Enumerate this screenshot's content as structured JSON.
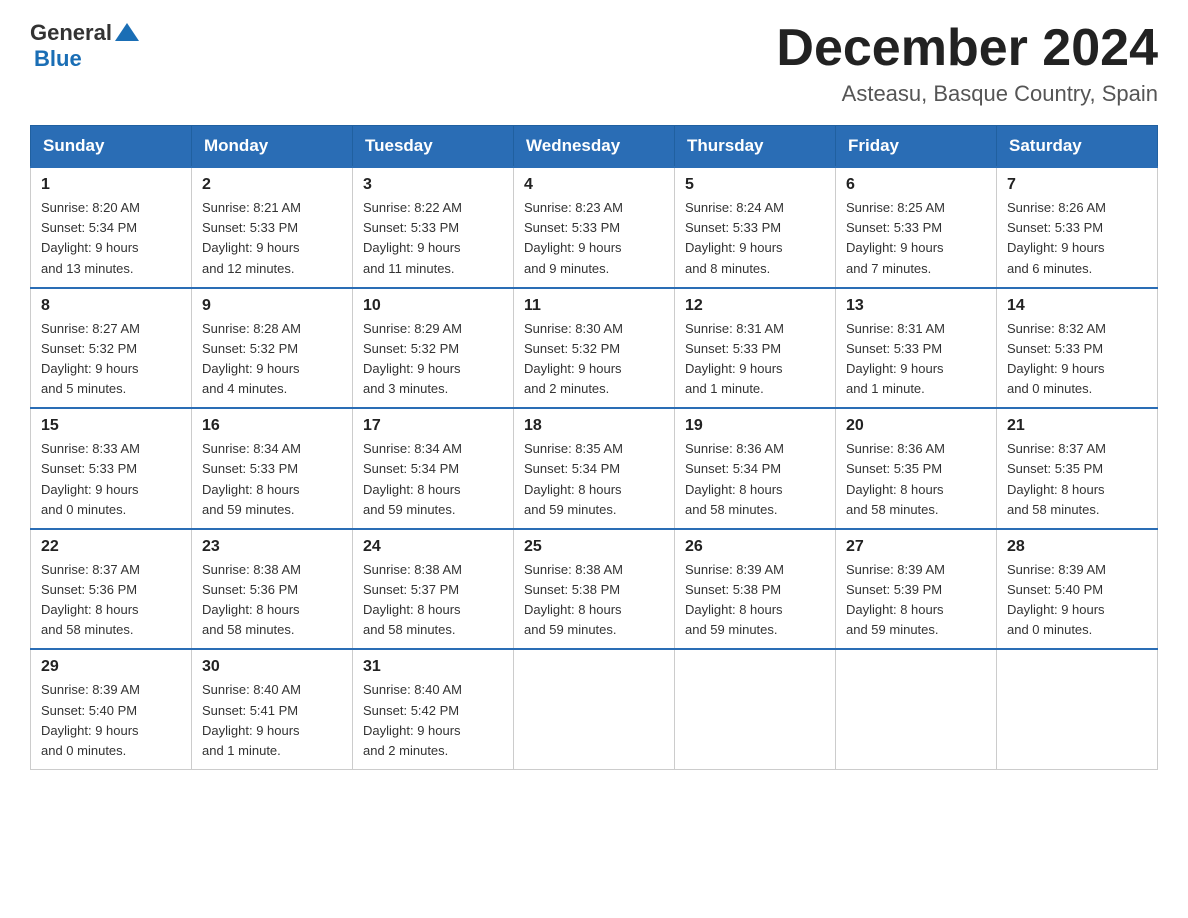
{
  "header": {
    "logo_general": "General",
    "logo_blue": "Blue",
    "month_title": "December 2024",
    "location": "Asteasu, Basque Country, Spain"
  },
  "weekdays": [
    "Sunday",
    "Monday",
    "Tuesday",
    "Wednesday",
    "Thursday",
    "Friday",
    "Saturday"
  ],
  "weeks": [
    [
      {
        "day": "1",
        "sunrise": "8:20 AM",
        "sunset": "5:34 PM",
        "daylight": "9 hours and 13 minutes."
      },
      {
        "day": "2",
        "sunrise": "8:21 AM",
        "sunset": "5:33 PM",
        "daylight": "9 hours and 12 minutes."
      },
      {
        "day": "3",
        "sunrise": "8:22 AM",
        "sunset": "5:33 PM",
        "daylight": "9 hours and 11 minutes."
      },
      {
        "day": "4",
        "sunrise": "8:23 AM",
        "sunset": "5:33 PM",
        "daylight": "9 hours and 9 minutes."
      },
      {
        "day": "5",
        "sunrise": "8:24 AM",
        "sunset": "5:33 PM",
        "daylight": "9 hours and 8 minutes."
      },
      {
        "day": "6",
        "sunrise": "8:25 AM",
        "sunset": "5:33 PM",
        "daylight": "9 hours and 7 minutes."
      },
      {
        "day": "7",
        "sunrise": "8:26 AM",
        "sunset": "5:33 PM",
        "daylight": "9 hours and 6 minutes."
      }
    ],
    [
      {
        "day": "8",
        "sunrise": "8:27 AM",
        "sunset": "5:32 PM",
        "daylight": "9 hours and 5 minutes."
      },
      {
        "day": "9",
        "sunrise": "8:28 AM",
        "sunset": "5:32 PM",
        "daylight": "9 hours and 4 minutes."
      },
      {
        "day": "10",
        "sunrise": "8:29 AM",
        "sunset": "5:32 PM",
        "daylight": "9 hours and 3 minutes."
      },
      {
        "day": "11",
        "sunrise": "8:30 AM",
        "sunset": "5:32 PM",
        "daylight": "9 hours and 2 minutes."
      },
      {
        "day": "12",
        "sunrise": "8:31 AM",
        "sunset": "5:33 PM",
        "daylight": "9 hours and 1 minute."
      },
      {
        "day": "13",
        "sunrise": "8:31 AM",
        "sunset": "5:33 PM",
        "daylight": "9 hours and 1 minute."
      },
      {
        "day": "14",
        "sunrise": "8:32 AM",
        "sunset": "5:33 PM",
        "daylight": "9 hours and 0 minutes."
      }
    ],
    [
      {
        "day": "15",
        "sunrise": "8:33 AM",
        "sunset": "5:33 PM",
        "daylight": "9 hours and 0 minutes."
      },
      {
        "day": "16",
        "sunrise": "8:34 AM",
        "sunset": "5:33 PM",
        "daylight": "8 hours and 59 minutes."
      },
      {
        "day": "17",
        "sunrise": "8:34 AM",
        "sunset": "5:34 PM",
        "daylight": "8 hours and 59 minutes."
      },
      {
        "day": "18",
        "sunrise": "8:35 AM",
        "sunset": "5:34 PM",
        "daylight": "8 hours and 59 minutes."
      },
      {
        "day": "19",
        "sunrise": "8:36 AM",
        "sunset": "5:34 PM",
        "daylight": "8 hours and 58 minutes."
      },
      {
        "day": "20",
        "sunrise": "8:36 AM",
        "sunset": "5:35 PM",
        "daylight": "8 hours and 58 minutes."
      },
      {
        "day": "21",
        "sunrise": "8:37 AM",
        "sunset": "5:35 PM",
        "daylight": "8 hours and 58 minutes."
      }
    ],
    [
      {
        "day": "22",
        "sunrise": "8:37 AM",
        "sunset": "5:36 PM",
        "daylight": "8 hours and 58 minutes."
      },
      {
        "day": "23",
        "sunrise": "8:38 AM",
        "sunset": "5:36 PM",
        "daylight": "8 hours and 58 minutes."
      },
      {
        "day": "24",
        "sunrise": "8:38 AM",
        "sunset": "5:37 PM",
        "daylight": "8 hours and 58 minutes."
      },
      {
        "day": "25",
        "sunrise": "8:38 AM",
        "sunset": "5:38 PM",
        "daylight": "8 hours and 59 minutes."
      },
      {
        "day": "26",
        "sunrise": "8:39 AM",
        "sunset": "5:38 PM",
        "daylight": "8 hours and 59 minutes."
      },
      {
        "day": "27",
        "sunrise": "8:39 AM",
        "sunset": "5:39 PM",
        "daylight": "8 hours and 59 minutes."
      },
      {
        "day": "28",
        "sunrise": "8:39 AM",
        "sunset": "5:40 PM",
        "daylight": "9 hours and 0 minutes."
      }
    ],
    [
      {
        "day": "29",
        "sunrise": "8:39 AM",
        "sunset": "5:40 PM",
        "daylight": "9 hours and 0 minutes."
      },
      {
        "day": "30",
        "sunrise": "8:40 AM",
        "sunset": "5:41 PM",
        "daylight": "9 hours and 1 minute."
      },
      {
        "day": "31",
        "sunrise": "8:40 AM",
        "sunset": "5:42 PM",
        "daylight": "9 hours and 2 minutes."
      },
      null,
      null,
      null,
      null
    ]
  ],
  "labels": {
    "sunrise": "Sunrise:",
    "sunset": "Sunset:",
    "daylight": "Daylight:"
  }
}
